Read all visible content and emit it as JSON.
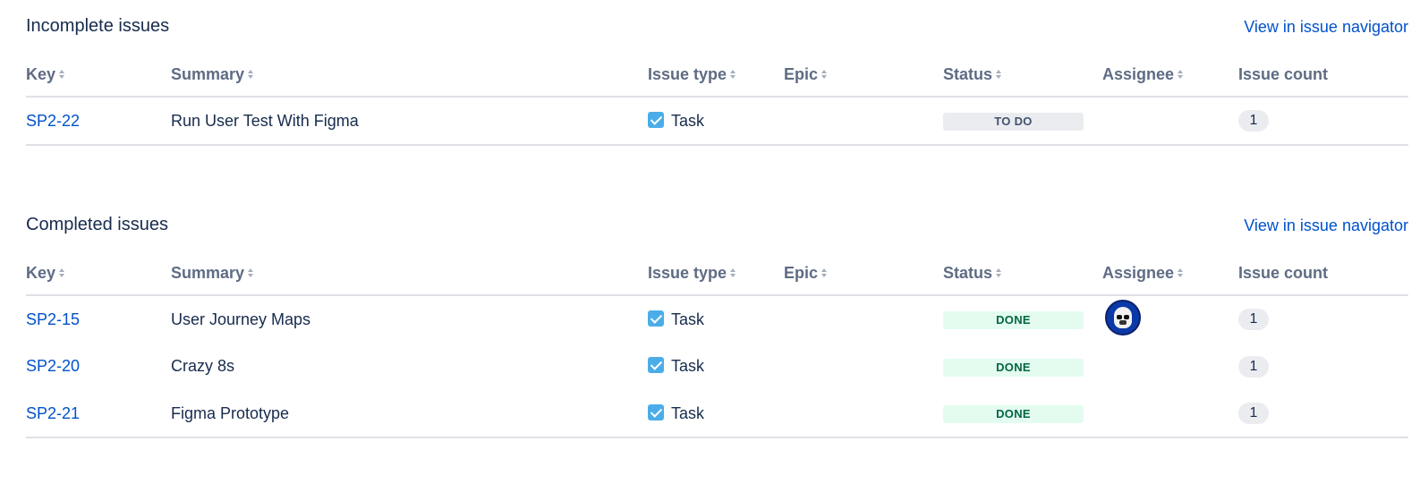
{
  "columns": {
    "key": "Key",
    "summary": "Summary",
    "issue_type": "Issue type",
    "epic": "Epic",
    "status": "Status",
    "assignee": "Assignee",
    "issue_count": "Issue count"
  },
  "incomplete": {
    "title": "Incomplete issues",
    "nav_link": "View in issue navigator",
    "rows": [
      {
        "key": "SP2-22",
        "summary": "Run User Test With Figma",
        "type": "Task",
        "epic": "",
        "status": "TO DO",
        "assignee_avatar": false,
        "count": "1"
      }
    ]
  },
  "completed": {
    "title": "Completed issues",
    "nav_link": "View in issue navigator",
    "rows": [
      {
        "key": "SP2-15",
        "summary": "User Journey Maps",
        "type": "Task",
        "epic": "",
        "status": "DONE",
        "assignee_avatar": true,
        "count": "1"
      },
      {
        "key": "SP2-20",
        "summary": "Crazy 8s",
        "type": "Task",
        "epic": "",
        "status": "DONE",
        "assignee_avatar": false,
        "count": "1"
      },
      {
        "key": "SP2-21",
        "summary": "Figma Prototype",
        "type": "Task",
        "epic": "",
        "status": "DONE",
        "assignee_avatar": false,
        "count": "1"
      }
    ]
  },
  "colors": {
    "link": "#0052cc",
    "task_icon": "#4bade8",
    "done_bg": "#e3fcef",
    "done_text": "#006644",
    "todo_bg": "#ebecf0",
    "todo_text": "#42526e"
  },
  "icons": {
    "task": "task-checkbox-icon",
    "sort": "sort-arrows-icon",
    "avatar": "stormtrooper-avatar"
  }
}
